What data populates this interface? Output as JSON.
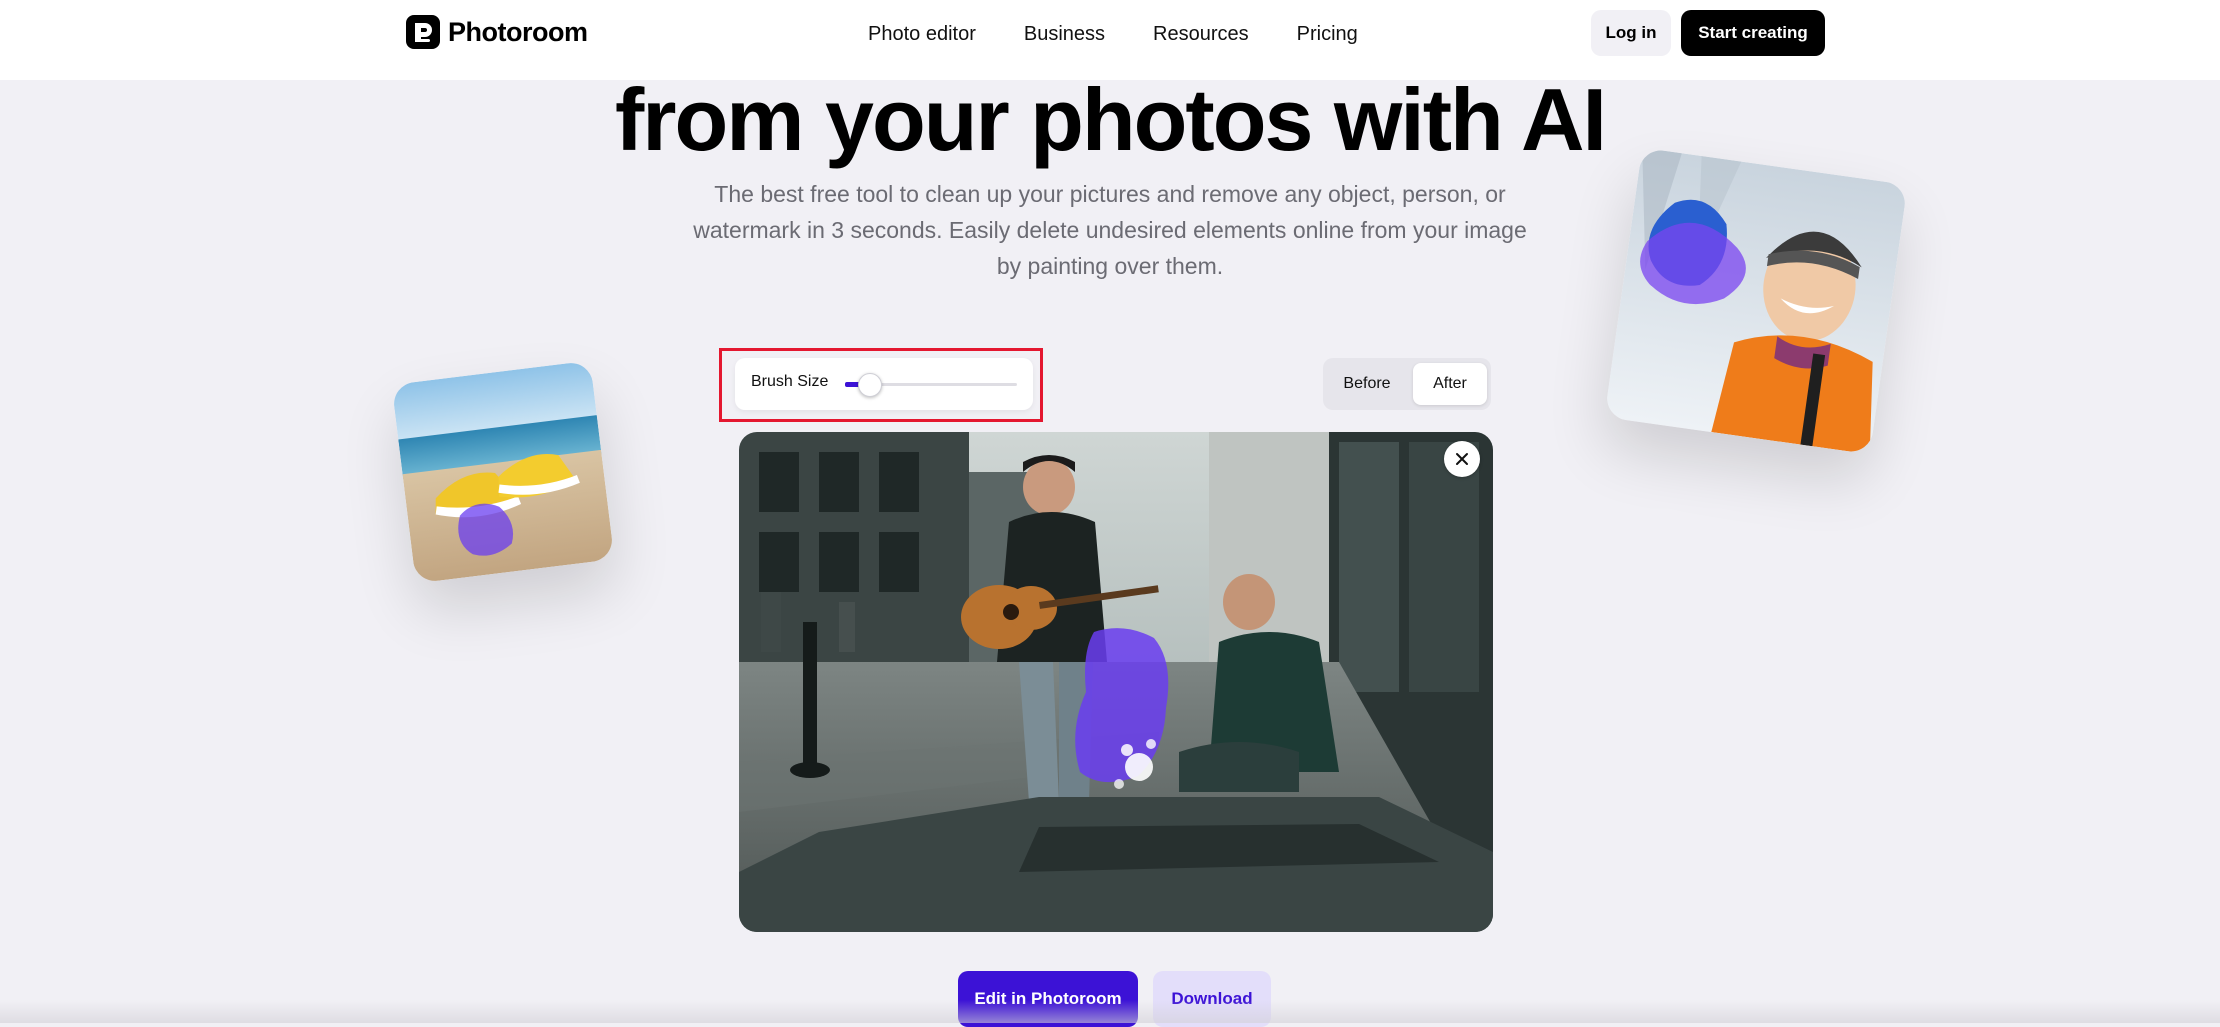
{
  "nav": {
    "logo_text": "Photoroom",
    "links": [
      "Photo editor",
      "Business",
      "Resources",
      "Pricing"
    ],
    "login_label": "Log in",
    "start_label": "Start creating"
  },
  "hero": {
    "headline": "from your photos with AI",
    "subtext": "The best free tool to clean up your pictures and remove any object, person, or watermark in 3 seconds. Easily delete undesired elements online from your image by painting over them."
  },
  "editor": {
    "brush_label": "Brush Size",
    "brush_size_fraction": 0.14,
    "toggle_before": "Before",
    "toggle_after": "After",
    "toggle_selected": "After"
  },
  "actions": {
    "edit_label": "Edit in Photoroom",
    "download_label": "Download"
  },
  "colors": {
    "accent": "#3c12d6",
    "highlight": "#e4172f",
    "background": "#f1f0f5"
  }
}
